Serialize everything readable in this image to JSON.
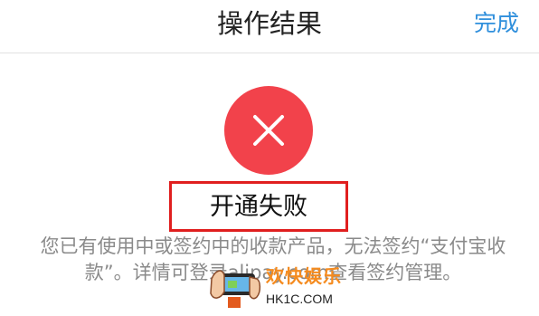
{
  "header": {
    "title": "操作结果",
    "done_label": "完成"
  },
  "result": {
    "status_icon": "close-icon",
    "status_color": "#f2424b",
    "title": "开通失败",
    "description": "您已有使用中或签约中的收款产品，无法签约“支付宝收款”。详情可登录alipay.com查看签约管理。"
  },
  "watermark": {
    "brand": "欢快娱乐",
    "domain": "HK1C.COM"
  },
  "colors": {
    "accent": "#2f8fdc",
    "error": "#f2424b",
    "highlight_border": "#e01f1f",
    "muted_text": "#8a8a8a"
  }
}
